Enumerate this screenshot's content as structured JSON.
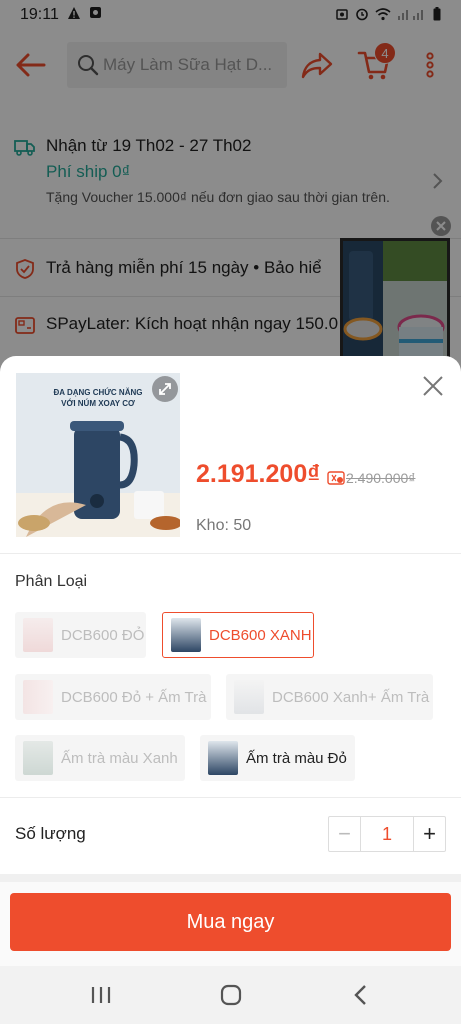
{
  "status_bar": {
    "time": "19:11"
  },
  "header": {
    "search_placeholder": "Máy Làm Sữa Hạt D...",
    "cart_count": "4"
  },
  "background": {
    "shipping": {
      "title": "Nhận từ 19 Th02 - 27 Th02",
      "fee": "Phí ship 0₫",
      "note": "Tặng Voucher 15.000₫ nếu đơn giao sau thời gian trên."
    },
    "return_text": "Trả hàng miễn phí 15 ngày  •  Bảo hiể",
    "spaylater_text": "SPayLater: Kích hoạt nhận ngay 150.0"
  },
  "sheet": {
    "image_caption_line1": "ĐA DẠNG CHỨC NĂNG",
    "image_caption_line2": "VỚI NÚM XOAY CƠ",
    "price": "2.191.200₫",
    "old_price": "2.490.000₫",
    "stock": "Kho: 50",
    "variant_title": "Phân Loại",
    "variants": [
      {
        "label": "DCB600 ĐỎ",
        "state": "disabled"
      },
      {
        "label": "DCB600 XANH",
        "state": "selected"
      },
      {
        "label": "DCB600 Đỏ + Ấm Trà",
        "state": "disabled"
      },
      {
        "label": "DCB600 Xanh+ Ấm Trà",
        "state": "disabled"
      },
      {
        "label": "Ấm trà màu Xanh",
        "state": "disabled"
      },
      {
        "label": "Ấm trà màu Đỏ",
        "state": "available"
      }
    ],
    "quantity_label": "Số lượng",
    "quantity_value": "1",
    "buy_label": "Mua ngay"
  },
  "colors": {
    "accent": "#ee4d2d",
    "ship_green": "#26aa99"
  }
}
